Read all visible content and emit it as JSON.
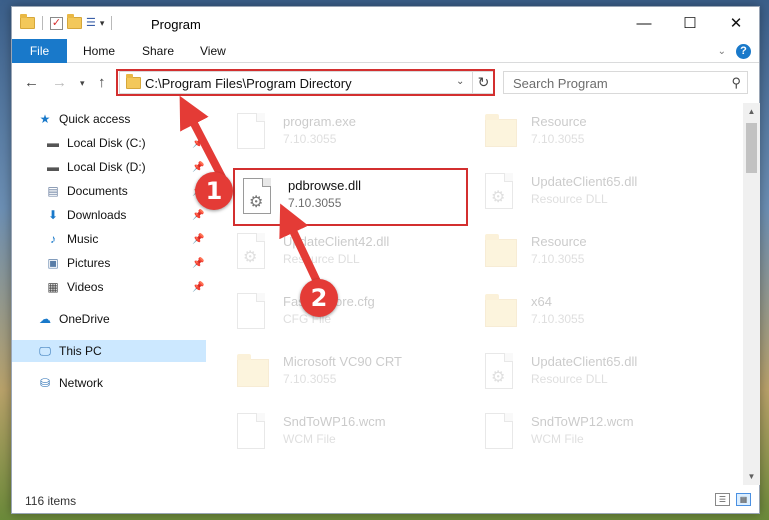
{
  "window": {
    "title": "Program"
  },
  "ribbon": {
    "file": "File",
    "home": "Home",
    "share": "Share",
    "view": "View",
    "help": "?"
  },
  "address": {
    "path": "C:\\Program Files\\Program Directory"
  },
  "search": {
    "placeholder": "Search Program"
  },
  "nav": {
    "quick_access": "Quick access",
    "items": [
      {
        "label": "Local Disk (C:)",
        "icon": "drive-icon"
      },
      {
        "label": "Local Disk (D:)",
        "icon": "drive-icon"
      },
      {
        "label": "Documents",
        "icon": "documents-icon"
      },
      {
        "label": "Downloads",
        "icon": "downloads-icon"
      },
      {
        "label": "Music",
        "icon": "music-icon"
      },
      {
        "label": "Pictures",
        "icon": "pictures-icon"
      },
      {
        "label": "Videos",
        "icon": "videos-icon"
      }
    ],
    "onedrive": "OneDrive",
    "this_pc": "This PC",
    "network": "Network"
  },
  "files": [
    {
      "name": "program.exe",
      "sub": "7.10.3055"
    },
    {
      "name": "Resource",
      "sub": "7.10.3055"
    },
    {
      "name": "pdbrowse.dll",
      "sub": "7.10.3055"
    },
    {
      "name": "UpdateClient65.dll",
      "sub": "Resource DLL"
    },
    {
      "name": "UpdateClient42.dll",
      "sub": "Resource DLL"
    },
    {
      "name": "Resource",
      "sub": "7.10.3055"
    },
    {
      "name": "FastRestore.cfg",
      "sub": "CFG File"
    },
    {
      "name": "x64",
      "sub": "7.10.3055"
    },
    {
      "name": "Microsoft VC90 CRT",
      "sub": "7.10.3055"
    },
    {
      "name": "UpdateClient65.dll",
      "sub": "Resource DLL"
    },
    {
      "name": "SndToWP16.wcm",
      "sub": "WCM File"
    },
    {
      "name": "SndToWP12.wcm",
      "sub": "WCM File"
    }
  ],
  "status": {
    "count": "116 items"
  },
  "annotations": {
    "step1": "1",
    "step2": "2"
  },
  "colors": {
    "accent": "#1979ca",
    "highlight": "#d32f2f",
    "marker": "#e43b36",
    "selection": "#cce8ff"
  }
}
